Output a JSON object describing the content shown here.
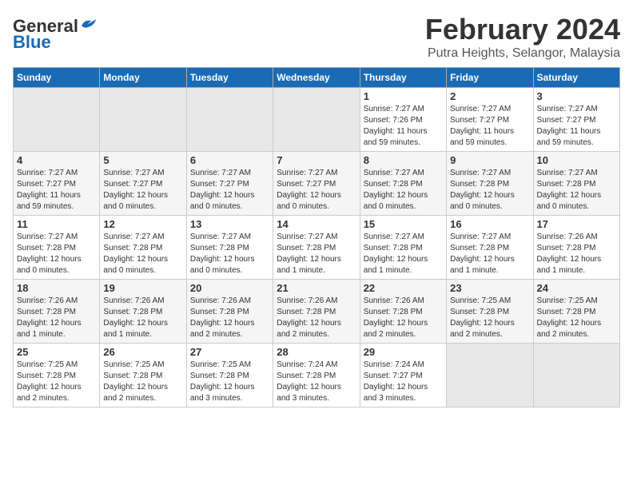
{
  "header": {
    "logo_general": "General",
    "logo_blue": "Blue",
    "main_title": "February 2024",
    "subtitle": "Putra Heights, Selangor, Malaysia"
  },
  "days_of_week": [
    "Sunday",
    "Monday",
    "Tuesday",
    "Wednesday",
    "Thursday",
    "Friday",
    "Saturday"
  ],
  "weeks": [
    [
      {
        "day": "",
        "info": ""
      },
      {
        "day": "",
        "info": ""
      },
      {
        "day": "",
        "info": ""
      },
      {
        "day": "",
        "info": ""
      },
      {
        "day": "1",
        "info": "Sunrise: 7:27 AM\nSunset: 7:26 PM\nDaylight: 11 hours\nand 59 minutes."
      },
      {
        "day": "2",
        "info": "Sunrise: 7:27 AM\nSunset: 7:27 PM\nDaylight: 11 hours\nand 59 minutes."
      },
      {
        "day": "3",
        "info": "Sunrise: 7:27 AM\nSunset: 7:27 PM\nDaylight: 11 hours\nand 59 minutes."
      }
    ],
    [
      {
        "day": "4",
        "info": "Sunrise: 7:27 AM\nSunset: 7:27 PM\nDaylight: 11 hours\nand 59 minutes."
      },
      {
        "day": "5",
        "info": "Sunrise: 7:27 AM\nSunset: 7:27 PM\nDaylight: 12 hours\nand 0 minutes."
      },
      {
        "day": "6",
        "info": "Sunrise: 7:27 AM\nSunset: 7:27 PM\nDaylight: 12 hours\nand 0 minutes."
      },
      {
        "day": "7",
        "info": "Sunrise: 7:27 AM\nSunset: 7:27 PM\nDaylight: 12 hours\nand 0 minutes."
      },
      {
        "day": "8",
        "info": "Sunrise: 7:27 AM\nSunset: 7:28 PM\nDaylight: 12 hours\nand 0 minutes."
      },
      {
        "day": "9",
        "info": "Sunrise: 7:27 AM\nSunset: 7:28 PM\nDaylight: 12 hours\nand 0 minutes."
      },
      {
        "day": "10",
        "info": "Sunrise: 7:27 AM\nSunset: 7:28 PM\nDaylight: 12 hours\nand 0 minutes."
      }
    ],
    [
      {
        "day": "11",
        "info": "Sunrise: 7:27 AM\nSunset: 7:28 PM\nDaylight: 12 hours\nand 0 minutes."
      },
      {
        "day": "12",
        "info": "Sunrise: 7:27 AM\nSunset: 7:28 PM\nDaylight: 12 hours\nand 0 minutes."
      },
      {
        "day": "13",
        "info": "Sunrise: 7:27 AM\nSunset: 7:28 PM\nDaylight: 12 hours\nand 0 minutes."
      },
      {
        "day": "14",
        "info": "Sunrise: 7:27 AM\nSunset: 7:28 PM\nDaylight: 12 hours\nand 1 minute."
      },
      {
        "day": "15",
        "info": "Sunrise: 7:27 AM\nSunset: 7:28 PM\nDaylight: 12 hours\nand 1 minute."
      },
      {
        "day": "16",
        "info": "Sunrise: 7:27 AM\nSunset: 7:28 PM\nDaylight: 12 hours\nand 1 minute."
      },
      {
        "day": "17",
        "info": "Sunrise: 7:26 AM\nSunset: 7:28 PM\nDaylight: 12 hours\nand 1 minute."
      }
    ],
    [
      {
        "day": "18",
        "info": "Sunrise: 7:26 AM\nSunset: 7:28 PM\nDaylight: 12 hours\nand 1 minute."
      },
      {
        "day": "19",
        "info": "Sunrise: 7:26 AM\nSunset: 7:28 PM\nDaylight: 12 hours\nand 1 minute."
      },
      {
        "day": "20",
        "info": "Sunrise: 7:26 AM\nSunset: 7:28 PM\nDaylight: 12 hours\nand 2 minutes."
      },
      {
        "day": "21",
        "info": "Sunrise: 7:26 AM\nSunset: 7:28 PM\nDaylight: 12 hours\nand 2 minutes."
      },
      {
        "day": "22",
        "info": "Sunrise: 7:26 AM\nSunset: 7:28 PM\nDaylight: 12 hours\nand 2 minutes."
      },
      {
        "day": "23",
        "info": "Sunrise: 7:25 AM\nSunset: 7:28 PM\nDaylight: 12 hours\nand 2 minutes."
      },
      {
        "day": "24",
        "info": "Sunrise: 7:25 AM\nSunset: 7:28 PM\nDaylight: 12 hours\nand 2 minutes."
      }
    ],
    [
      {
        "day": "25",
        "info": "Sunrise: 7:25 AM\nSunset: 7:28 PM\nDaylight: 12 hours\nand 2 minutes."
      },
      {
        "day": "26",
        "info": "Sunrise: 7:25 AM\nSunset: 7:28 PM\nDaylight: 12 hours\nand 2 minutes."
      },
      {
        "day": "27",
        "info": "Sunrise: 7:25 AM\nSunset: 7:28 PM\nDaylight: 12 hours\nand 3 minutes."
      },
      {
        "day": "28",
        "info": "Sunrise: 7:24 AM\nSunset: 7:28 PM\nDaylight: 12 hours\nand 3 minutes."
      },
      {
        "day": "29",
        "info": "Sunrise: 7:24 AM\nSunset: 7:27 PM\nDaylight: 12 hours\nand 3 minutes."
      },
      {
        "day": "",
        "info": ""
      },
      {
        "day": "",
        "info": ""
      }
    ]
  ]
}
